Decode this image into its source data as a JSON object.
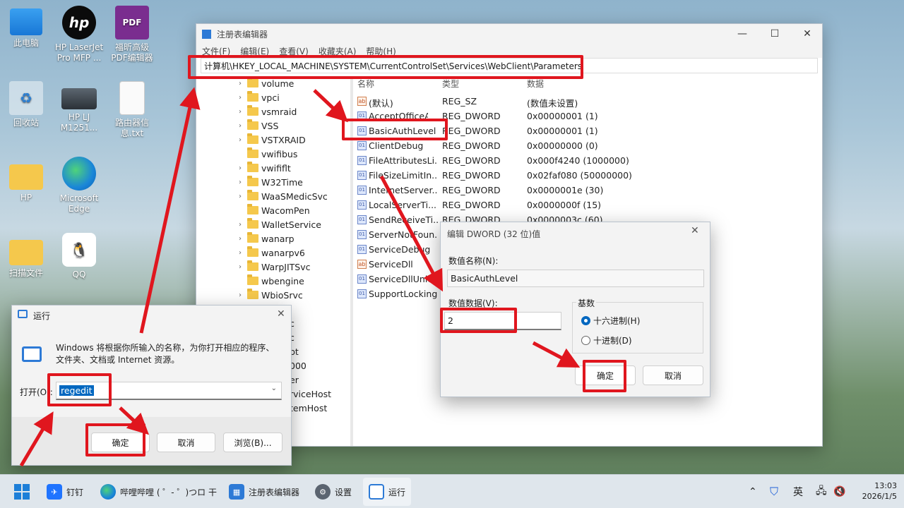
{
  "desktop": {
    "icons": [
      {
        "label": "此电脑",
        "icon": "monitor-icon"
      },
      {
        "label": "HP LaserJet Pro MFP ...",
        "icon": "hp-icon"
      },
      {
        "label": "福昕高级PDF编辑器",
        "icon": "pdf-icon"
      },
      {
        "label": "回收站",
        "icon": "recycle-bin-icon"
      },
      {
        "label": "HP LJ M1251...",
        "icon": "scanner-icon"
      },
      {
        "label": "路由器信息.txt",
        "icon": "text-file-icon"
      },
      {
        "label": "HP",
        "icon": "folder-icon"
      },
      {
        "label": "Microsoft Edge",
        "icon": "edge-icon"
      },
      {
        "label": "扫描文件",
        "icon": "folder-icon"
      },
      {
        "label": "QQ",
        "icon": "qq-icon"
      }
    ]
  },
  "regedit": {
    "title": "注册表编辑器",
    "menu": [
      "文件(F)",
      "编辑(E)",
      "查看(V)",
      "收藏夹(A)",
      "帮助(H)"
    ],
    "address": "计算机\\HKEY_LOCAL_MACHINE\\SYSTEM\\CurrentControlSet\\Services\\WebClient\\Parameters",
    "tree": [
      {
        "label": "volume",
        "has_children": true
      },
      {
        "label": "vpci",
        "has_children": true
      },
      {
        "label": "vsmraid",
        "has_children": true
      },
      {
        "label": "VSS",
        "has_children": true
      },
      {
        "label": "VSTXRAID",
        "has_children": true
      },
      {
        "label": "vwifibus",
        "has_children": false
      },
      {
        "label": "vwififlt",
        "has_children": true
      },
      {
        "label": "W32Time",
        "has_children": true
      },
      {
        "label": "WaaSMedicSvc",
        "has_children": true
      },
      {
        "label": "WacomPen",
        "has_children": false
      },
      {
        "label": "WalletService",
        "has_children": true
      },
      {
        "label": "wanarp",
        "has_children": true
      },
      {
        "label": "wanarpv6",
        "has_children": true
      },
      {
        "label": "WarpJITSvc",
        "has_children": true
      },
      {
        "label": "wbengine",
        "has_children": false
      },
      {
        "label": "WbioSrvc",
        "has_children": true
      }
    ],
    "tree_partial": [
      "c",
      "c",
      "pt",
      "000",
      "er",
      "rviceHost",
      "temHost"
    ],
    "columns": [
      "名称",
      "类型",
      "数据"
    ],
    "values": [
      {
        "name": "(默认)",
        "type": "REG_SZ",
        "data": "(数值未设置)",
        "kind": "ab"
      },
      {
        "name": "AcceptOfficeA...",
        "type": "REG_DWORD",
        "data": "0x00000001 (1)",
        "kind": "dword"
      },
      {
        "name": "BasicAuthLevel",
        "type": "REG_DWORD",
        "data": "0x00000001 (1)",
        "kind": "dword"
      },
      {
        "name": "ClientDebug",
        "type": "REG_DWORD",
        "data": "0x00000000 (0)",
        "kind": "dword"
      },
      {
        "name": "FileAttributesLi...",
        "type": "REG_DWORD",
        "data": "0x000f4240 (1000000)",
        "kind": "dword"
      },
      {
        "name": "FileSizeLimitIn...",
        "type": "REG_DWORD",
        "data": "0x02faf080 (50000000)",
        "kind": "dword"
      },
      {
        "name": "InternetServer...",
        "type": "REG_DWORD",
        "data": "0x0000001e (30)",
        "kind": "dword"
      },
      {
        "name": "LocalServerTi...",
        "type": "REG_DWORD",
        "data": "0x0000000f (15)",
        "kind": "dword"
      },
      {
        "name": "SendReceiveTi...",
        "type": "REG_DWORD",
        "data": "0x0000003c (60)",
        "kind": "dword"
      },
      {
        "name": "ServerNotFoun...",
        "type": "",
        "data": "",
        "kind": "dword"
      },
      {
        "name": "ServiceDebug",
        "type": "",
        "data": "",
        "kind": "dword"
      },
      {
        "name": "ServiceDll",
        "type": "",
        "data": "",
        "kind": "ab"
      },
      {
        "name": "ServiceDllUnlo...",
        "type": "",
        "data": "",
        "kind": "dword"
      },
      {
        "name": "SupportLocking",
        "type": "",
        "data": "",
        "kind": "dword"
      }
    ]
  },
  "edit_dword": {
    "title": "编辑 DWORD (32 位)值",
    "name_label": "数值名称(N):",
    "name_value": "BasicAuthLevel",
    "data_label": "数值数据(V):",
    "data_value": "2",
    "base_label": "基数",
    "hex_label": "十六进制(H)",
    "dec_label": "十进制(D)",
    "selected_base": "hex",
    "ok": "确定",
    "cancel": "取消"
  },
  "run": {
    "title": "运行",
    "description": "Windows 将根据你所输入的名称，为你打开相应的程序、文件夹、文档或 Internet 资源。",
    "open_label": "打开(O):",
    "input_value": "regedit",
    "ok": "确定",
    "cancel": "取消",
    "browse": "浏览(B)..."
  },
  "taskbar": {
    "apps": [
      {
        "label": "钉钉",
        "icon": "dingtalk-icon"
      },
      {
        "label": "哔哩哔哩 ( ゜- ゜)つロ 干",
        "icon": "edge-icon"
      },
      {
        "label": "注册表编辑器",
        "icon": "regedit-icon"
      },
      {
        "label": "设置",
        "icon": "settings-icon"
      },
      {
        "label": "运行",
        "icon": "run-icon"
      }
    ],
    "ime": "英",
    "time": "13:03",
    "date": "2026/1/5"
  },
  "colors": {
    "highlight": "#e0161e",
    "accent": "#0067c0"
  }
}
